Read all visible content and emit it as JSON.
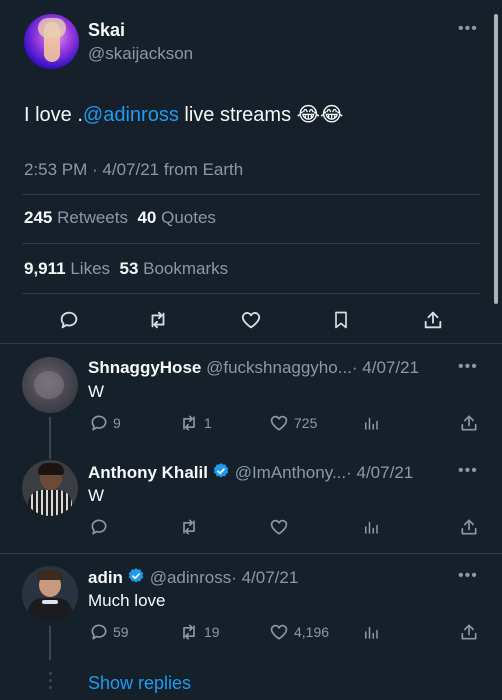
{
  "main_tweet": {
    "display_name": "Skai",
    "handle": "@skaijackson",
    "text_before": "I love .",
    "mention": "@adinross",
    "text_after": " live streams 😂😂",
    "timestamp": "2:53 PM · 4/07/21 from Earth",
    "retweets_count": "245",
    "retweets_label": "Retweets",
    "quotes_count": "40",
    "quotes_label": "Quotes",
    "likes_count": "9,911",
    "likes_label": "Likes",
    "bookmarks_count": "53",
    "bookmarks_label": "Bookmarks"
  },
  "replies": [
    {
      "display_name": "ShnaggyHose",
      "handle": "@fuckshnaggyho...",
      "date": "· 4/07/21",
      "text": "W",
      "reply_count": "9",
      "retweet_count": "1",
      "like_count": "725"
    },
    {
      "display_name": "Anthony Khalil",
      "handle": "@ImAnthony...",
      "date": "· 4/07/21",
      "text": "W",
      "reply_count": "",
      "retweet_count": "",
      "like_count": ""
    },
    {
      "display_name": "adin",
      "handle": "@adinross",
      "date": "· 4/07/21",
      "text": "Much love",
      "reply_count": "59",
      "retweet_count": "19",
      "like_count": "4,196"
    }
  ],
  "show_replies": "Show replies",
  "colors": {
    "background": "#15202b",
    "accent": "#1d9bf0",
    "muted": "#8b98a5"
  }
}
